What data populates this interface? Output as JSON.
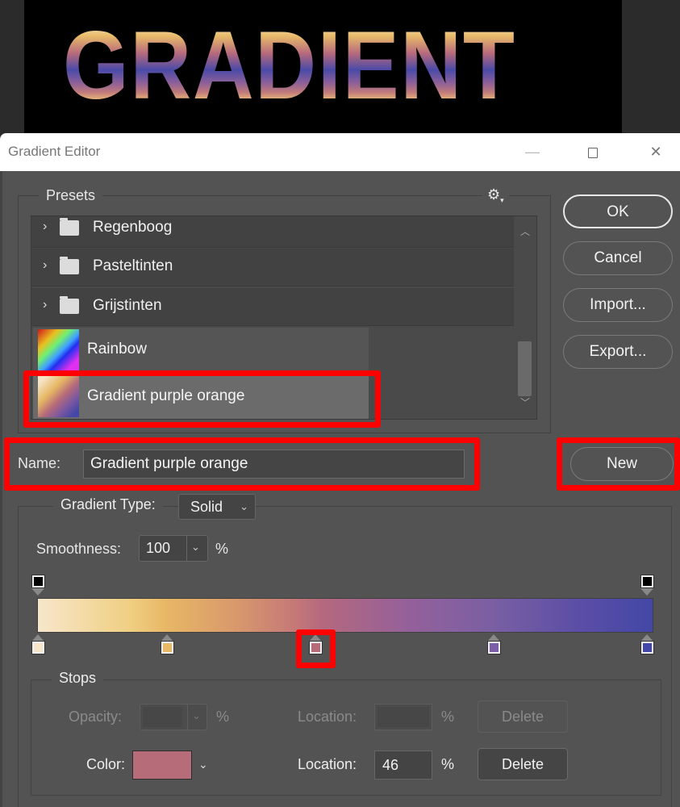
{
  "canvas": {
    "banner_text": "GRADIENT"
  },
  "window": {
    "title": "Gradient Editor",
    "controls": {
      "minimize_icon": "—",
      "close_icon": "✕"
    }
  },
  "presets": {
    "label": "Presets",
    "gear_icon": "⚙",
    "gear_caret": "▾",
    "folders": [
      {
        "label": "Regenboog",
        "chevron": "›"
      },
      {
        "label": "Pasteltinten",
        "chevron": "›"
      },
      {
        "label": "Grijstinten",
        "chevron": "›"
      }
    ],
    "gradients": [
      {
        "label": "Rainbow",
        "selected": false
      },
      {
        "label": "Gradient purple orange",
        "selected": true
      }
    ],
    "scroll_up_icon": "︿",
    "scroll_down_icon": "﹀"
  },
  "buttons": {
    "ok": "OK",
    "cancel": "Cancel",
    "import": "Import...",
    "export": "Export...",
    "new": "New"
  },
  "name": {
    "label": "Name:",
    "value": "Gradient purple orange"
  },
  "gradient_type": {
    "label": "Gradient Type:",
    "value": "Solid",
    "caret": "⌄"
  },
  "smoothness": {
    "label": "Smoothness:",
    "value": "100",
    "caret": "⌄",
    "unit": "%"
  },
  "gradient_bar": {
    "opacity_stops": [
      {
        "location_pct": 0,
        "color": "#000000"
      },
      {
        "location_pct": 100,
        "color": "#000000"
      }
    ],
    "color_stops": [
      {
        "location_pct": 0,
        "color": "#f6e6cc"
      },
      {
        "location_pct": 21,
        "color": "#e8b967"
      },
      {
        "location_pct": 46,
        "color": "#b76c7a",
        "selected": true
      },
      {
        "location_pct": 74,
        "color": "#7a5fa8"
      },
      {
        "location_pct": 100,
        "color": "#4447a8"
      }
    ]
  },
  "stops": {
    "label": "Stops",
    "opacity": {
      "label": "Opacity:",
      "value": "",
      "caret": "⌄",
      "unit": "%",
      "location_label": "Location:",
      "location_value": "",
      "location_unit": "%",
      "delete_label": "Delete",
      "enabled": false
    },
    "color": {
      "label": "Color:",
      "swatch": "#b76c7a",
      "caret": "⌄",
      "location_label": "Location:",
      "location_value": "46",
      "location_unit": "%",
      "delete_label": "Delete",
      "enabled": true
    }
  },
  "highlight_color": "#ff0000"
}
